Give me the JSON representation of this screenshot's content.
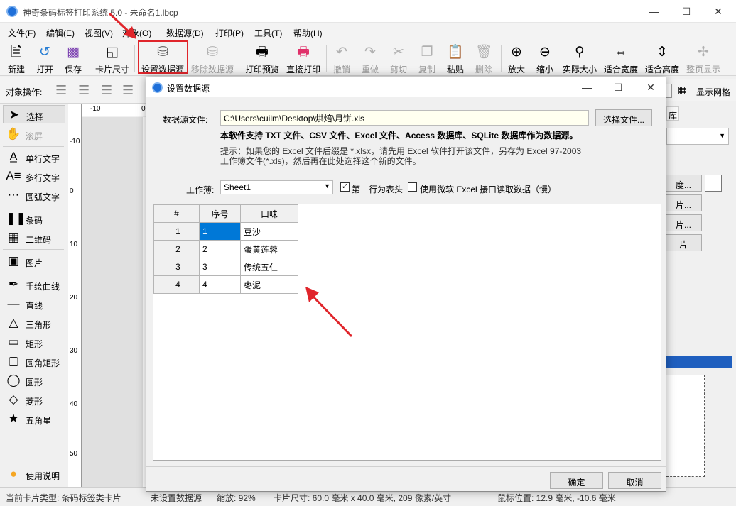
{
  "window": {
    "title": "神奇条码标签打印系统 5.0 - 未命名1.lbcp"
  },
  "menu": [
    "文件(F)",
    "编辑(E)",
    "视图(V)",
    "对象(O)",
    "数据源(D)",
    "打印(P)",
    "工具(T)",
    "帮助(H)"
  ],
  "toolbar": [
    {
      "label": "新建",
      "icon": "new-file-icon",
      "enabled": true
    },
    {
      "label": "打开",
      "icon": "open-icon",
      "enabled": true
    },
    {
      "label": "保存",
      "icon": "save-icon",
      "enabled": true
    },
    {
      "label": "卡片尺寸",
      "icon": "card-size-icon",
      "enabled": true
    },
    {
      "label": "设置数据源",
      "icon": "database-icon",
      "enabled": true
    },
    {
      "label": "移除数据源",
      "icon": "database-remove-icon",
      "enabled": false
    },
    {
      "label": "打印预览",
      "icon": "print-preview-icon",
      "enabled": true
    },
    {
      "label": "直接打印",
      "icon": "printer-icon",
      "enabled": true
    },
    {
      "label": "撤销",
      "icon": "undo-icon",
      "enabled": false
    },
    {
      "label": "重做",
      "icon": "redo-icon",
      "enabled": false
    },
    {
      "label": "剪切",
      "icon": "cut-icon",
      "enabled": false
    },
    {
      "label": "复制",
      "icon": "copy-icon",
      "enabled": false
    },
    {
      "label": "粘贴",
      "icon": "paste-icon",
      "enabled": true
    },
    {
      "label": "删除",
      "icon": "delete-icon",
      "enabled": false
    },
    {
      "label": "放大",
      "icon": "zoom-in-icon",
      "enabled": true
    },
    {
      "label": "缩小",
      "icon": "zoom-out-icon",
      "enabled": true
    },
    {
      "label": "实际大小",
      "icon": "actual-size-icon",
      "enabled": true
    },
    {
      "label": "适合宽度",
      "icon": "fit-width-icon",
      "enabled": true
    },
    {
      "label": "适合高度",
      "icon": "fit-height-icon",
      "enabled": true
    },
    {
      "label": "整页显示",
      "icon": "full-page-icon",
      "enabled": false
    }
  ],
  "objbar": {
    "label": "对象操作:",
    "show_grid": "显示网格"
  },
  "tools": [
    {
      "label": "选择",
      "icon": "pointer-icon"
    },
    {
      "label": "滚屏",
      "icon": "hand-icon"
    },
    {
      "label": "单行文字",
      "icon": "single-line-text-icon"
    },
    {
      "label": "多行文字",
      "icon": "multi-line-text-icon"
    },
    {
      "label": "圆弧文字",
      "icon": "arc-text-icon"
    },
    {
      "label": "条码",
      "icon": "barcode-icon"
    },
    {
      "label": "二维码",
      "icon": "qrcode-icon"
    },
    {
      "label": "图片",
      "icon": "image-icon"
    },
    {
      "label": "手绘曲线",
      "icon": "pen-icon"
    },
    {
      "label": "直线",
      "icon": "line-icon"
    },
    {
      "label": "三角形",
      "icon": "triangle-icon"
    },
    {
      "label": "矩形",
      "icon": "rectangle-icon"
    },
    {
      "label": "圆角矩形",
      "icon": "rounded-rectangle-icon"
    },
    {
      "label": "圆形",
      "icon": "circle-icon"
    },
    {
      "label": "菱形",
      "icon": "diamond-icon"
    },
    {
      "label": "五角星",
      "icon": "star-icon"
    },
    {
      "label": "使用说明",
      "icon": "lightbulb-icon"
    }
  ],
  "ruler": {
    "h": [
      "-10",
      "0"
    ],
    "v": [
      "-10",
      "0",
      "10",
      "20",
      "30",
      "40",
      "50"
    ]
  },
  "rightpanel": {
    "tab": "库",
    "btn1": "度...",
    "btn2": "片...",
    "btn3": "片...",
    "btn4": "片"
  },
  "status": {
    "card_type": "当前卡片类型: 条码标签类卡片",
    "datasource": "未设置数据源",
    "zoom": "缩放: 92%",
    "card_size": "卡片尺寸: 60.0 毫米 x 40.0 毫米, 209 像素/英寸",
    "mouse": "鼠标位置: 12.9 毫米, -10.6 毫米"
  },
  "dialog": {
    "title": "设置数据源",
    "file_label": "数据源文件:",
    "file_path": "C:\\Users\\cuilm\\Desktop\\烘焙\\月饼.xls",
    "choose_button": "选择文件...",
    "support_text": "本软件支持 TXT 文件、CSV 文件、Excel 文件、Access 数据库、SQLite 数据库作为数据源。",
    "hint_line1": "提示：如果您的 Excel 文件后缀是 *.xlsx，请先用 Excel 软件打开该文件，另存为 Excel 97-2003",
    "hint_line2": "工作簿文件(*.xls)，然后再在此处选择这个新的文件。",
    "sheet_label": "工作薄:",
    "sheet_value": "Sheet1",
    "first_row_header": "第一行为表头",
    "first_row_checked": "✓",
    "use_ms_excel": "使用微软 Excel 接口读取数据（慢）",
    "table": {
      "headers": [
        "#",
        "序号",
        "口味"
      ],
      "rows": [
        [
          "1",
          "1",
          "豆沙"
        ],
        [
          "2",
          "2",
          "蛋黄莲蓉"
        ],
        [
          "3",
          "3",
          "传统五仁"
        ],
        [
          "4",
          "4",
          "枣泥"
        ]
      ]
    },
    "ok_button": "确定",
    "cancel_button": "取消"
  },
  "colors": {
    "accent": "#0078d7",
    "highlight": "#e0252b"
  }
}
